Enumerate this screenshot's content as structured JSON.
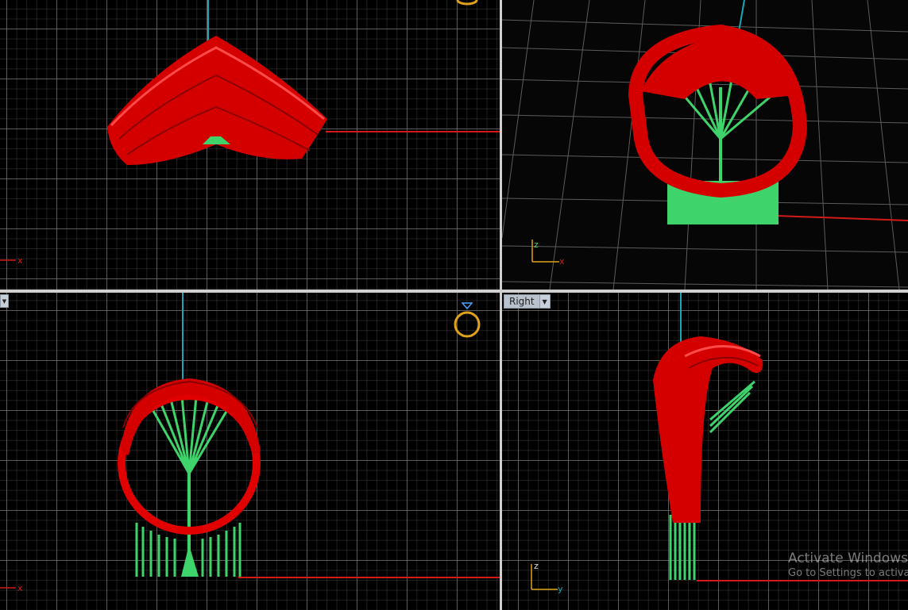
{
  "viewports": {
    "top": {
      "axis_x": "x"
    },
    "perspective": {
      "axis_x": "x",
      "axis_z": "z"
    },
    "front": {
      "axis_x": "x"
    },
    "right": {
      "title": "Right",
      "axis_z": "z",
      "axis_y": "y"
    }
  },
  "colors": {
    "ring_red": "#e10000",
    "support_green": "#3fd46b",
    "axis_x": "#d11a1a",
    "axis_z": "#1aa7b8",
    "grid": "#8c8c8c",
    "gumball": "#e0a21a"
  },
  "icons": {
    "dropdown": "chevron-down-icon",
    "ring_widget": "ring-icon"
  },
  "watermark": {
    "line1": "Activate Windows",
    "line2": "Go to Settings to activate Windows."
  }
}
